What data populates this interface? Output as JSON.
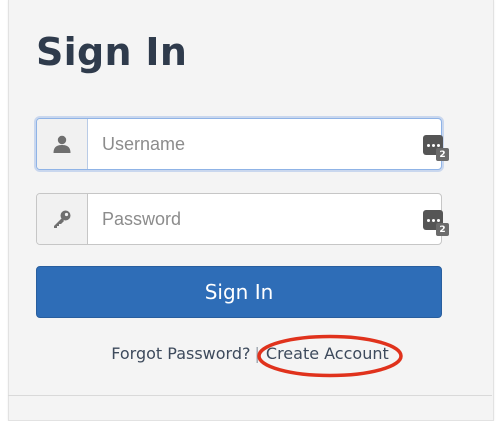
{
  "signin": {
    "title": "Sign In",
    "username": {
      "placeholder": "Username",
      "value": "",
      "icon": "user-icon"
    },
    "password": {
      "placeholder": "Password",
      "value": "",
      "icon": "key-icon"
    },
    "password_manager": {
      "count": "2",
      "icon": "password-manager-icon"
    },
    "submit_label": "Sign In",
    "forgot_password": "Forgot Password?",
    "separator": "|",
    "create_account": "Create Account"
  },
  "colors": {
    "primary_button": "#2e6db7",
    "title_text": "#2f3b4c",
    "annotation_circle": "#e0321c",
    "focus_border": "#8fb3e6"
  }
}
